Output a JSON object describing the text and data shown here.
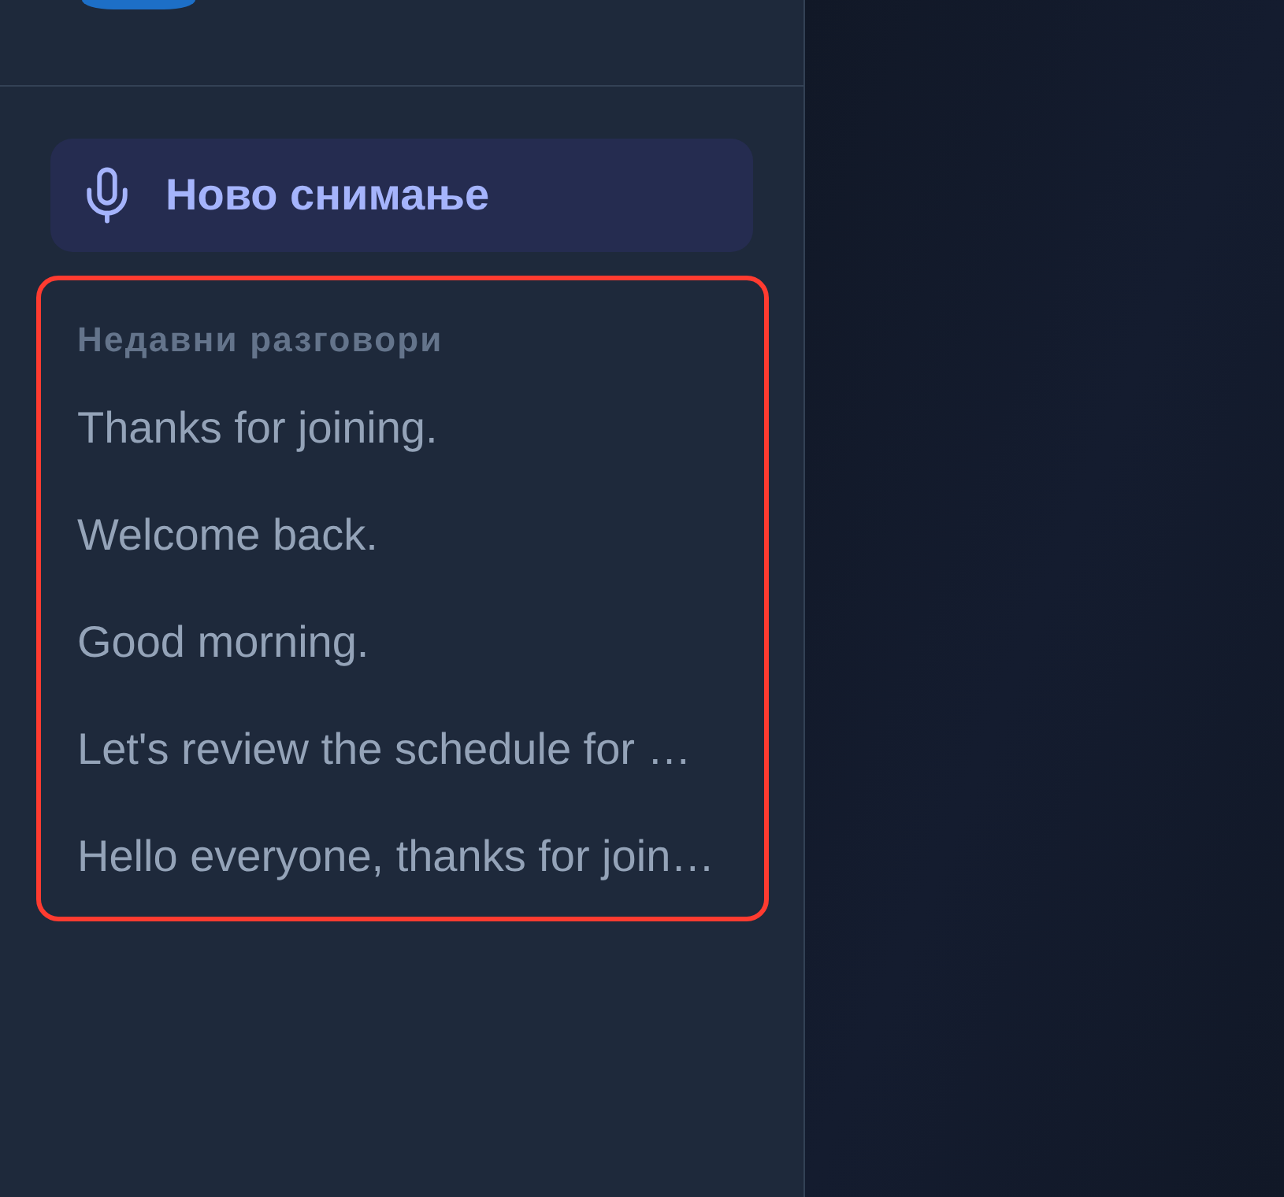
{
  "new_recording": {
    "label": "Ново снимање"
  },
  "recent": {
    "highlighted": true,
    "heading": "Недавни разговори",
    "items": [
      {
        "title": "Thanks for joining."
      },
      {
        "title": "Welcome back."
      },
      {
        "title": "Good morning."
      },
      {
        "title": "Let's review the schedule for …"
      },
      {
        "title": "Hello everyone, thanks for join…"
      }
    ]
  }
}
